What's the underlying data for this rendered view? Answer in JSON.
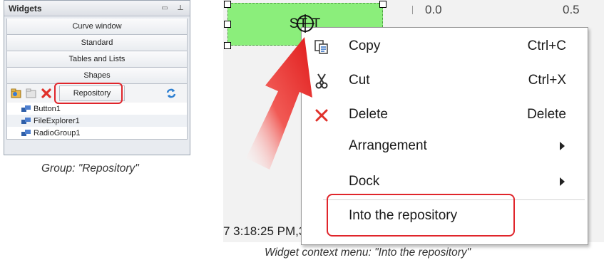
{
  "widgets_panel": {
    "title": "Widgets",
    "header_buttons": [
      "restore-icon",
      "pin-icon"
    ],
    "groups": [
      "Curve window",
      "Standard",
      "Tables and Lists",
      "Shapes"
    ],
    "toolbar_icons": [
      "add-folder-icon",
      "open-folder-icon",
      "delete-icon",
      "refresh-icon"
    ],
    "repository_label": "Repository",
    "repository_items": [
      "Button1",
      "FileExplorer1",
      "RadioGroup1"
    ]
  },
  "captions": {
    "left": "Group: \"Repository\"",
    "right": "Widget context menu: \"Into the repository\""
  },
  "designer": {
    "axis_labels": [
      "0.0",
      "0.5"
    ],
    "button_label": "ST  T",
    "status_text": "7 3:18:25 PM,3\""
  },
  "context_menu": {
    "items": [
      {
        "icon": "copy-icon",
        "label": "Copy",
        "shortcut": "Ctrl+C"
      },
      {
        "icon": "cut-icon",
        "label": "Cut",
        "shortcut": "Ctrl+X"
      },
      {
        "icon": "delete-icon",
        "label": "Delete",
        "shortcut": "Delete"
      },
      {
        "icon": "",
        "label": "Arrangement",
        "shortcut": ""
      },
      {
        "icon": "",
        "label": "Dock",
        "shortcut": ""
      },
      {
        "icon": "",
        "label": "Into the repository",
        "shortcut": ""
      }
    ]
  },
  "colors": {
    "highlight": "#e0252b",
    "button_green": "#8bee7b",
    "widget_icon": "#2f5fa8"
  }
}
